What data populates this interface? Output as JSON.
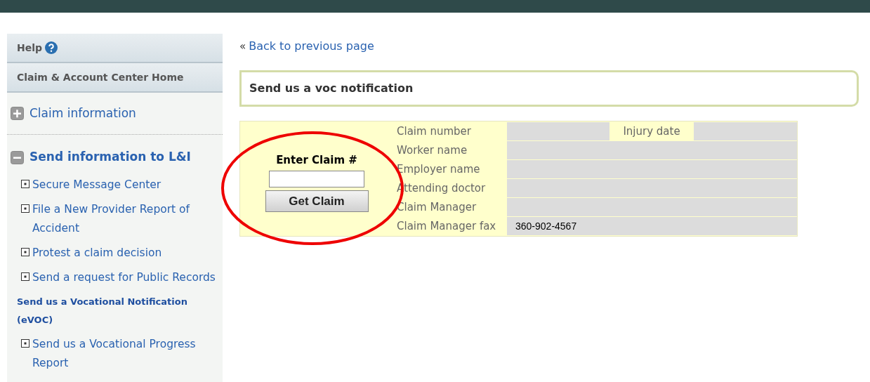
{
  "sidebar": {
    "top_links": [
      {
        "label": "Help",
        "help_icon": true
      },
      {
        "label": "Claim & Account Center Home",
        "help_icon": false
      }
    ],
    "sections": [
      {
        "label": "Claim information",
        "expanded": false
      },
      {
        "label": "Send information to L&I",
        "expanded": true,
        "children": [
          {
            "label": "Secure Message Center",
            "selected": false
          },
          {
            "label": "File a New Provider Report of Accident",
            "selected": false
          },
          {
            "label": "Protest a claim decision",
            "selected": false
          },
          {
            "label": "Send a request for Public Records",
            "selected": false
          },
          {
            "label": "Send us a Vocational Notification (eVOC)",
            "selected": true
          },
          {
            "label": "Send us a Vocational Progress Report",
            "selected": false
          }
        ]
      }
    ]
  },
  "back_link": {
    "marker": "«",
    "label": "Back to previous page"
  },
  "title": "Send us a voc notification",
  "claim_lookup": {
    "label": "Enter Claim #",
    "button": "Get Claim"
  },
  "fields": [
    {
      "label": "Claim number",
      "extra_label": "Injury date"
    },
    {
      "label": "Worker name"
    },
    {
      "label": "Employer name"
    },
    {
      "label": "Attending doctor"
    },
    {
      "label": "Claim Manager"
    },
    {
      "label": "Claim Manager fax",
      "value": "360-902-4567"
    }
  ]
}
